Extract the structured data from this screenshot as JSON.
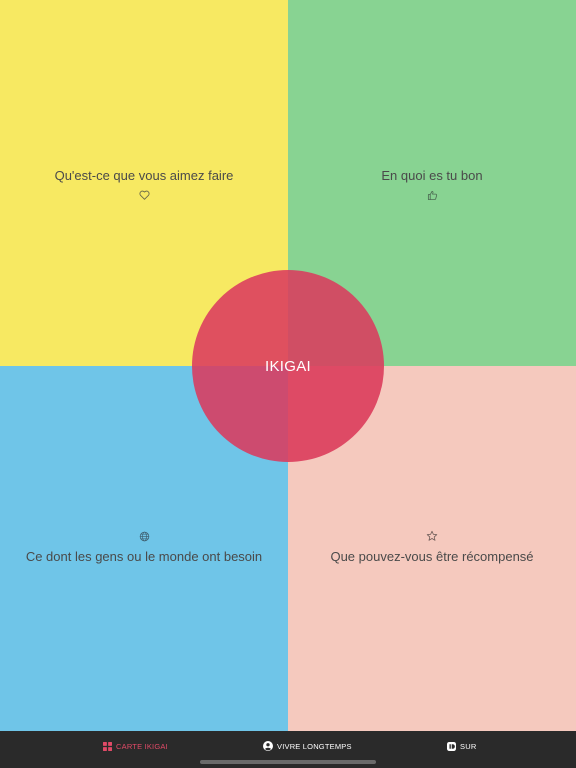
{
  "colors": {
    "quad_top_left": "#f7e962",
    "quad_top_right": "#88d392",
    "quad_bottom_left": "#6fc5e8",
    "quad_bottom_right": "#f5c9be",
    "circle_top_left": "#df505f",
    "circle_top_right": "#d04e64",
    "circle_bottom_left": "#cd4b6f",
    "circle_bottom_right": "#de4a65",
    "tabbar_bg": "#2a2a2a",
    "tab_active": "#e14a67",
    "tab_inactive": "#ffffff"
  },
  "quadrants": {
    "top_left": {
      "label": "Qu'est-ce que vous aimez faire",
      "icon": "heart-icon"
    },
    "top_right": {
      "label": "En quoi es tu bon",
      "icon": "thumbs-up-icon"
    },
    "bottom_left": {
      "label": "Ce dont les gens ou le monde ont besoin",
      "icon": "globe-icon"
    },
    "bottom_right": {
      "label": "Que pouvez-vous être récompensé",
      "icon": "star-icon"
    }
  },
  "center": {
    "label": "IKIGAI"
  },
  "tabbar": {
    "tabs": [
      {
        "label": "CARTE IKIGAI",
        "icon": "grid-icon",
        "active": true
      },
      {
        "label": "VIVRE LONGTEMPS",
        "icon": "user-circle-icon",
        "active": false
      },
      {
        "label": "SUR",
        "icon": "info-square-icon",
        "active": false
      }
    ]
  }
}
